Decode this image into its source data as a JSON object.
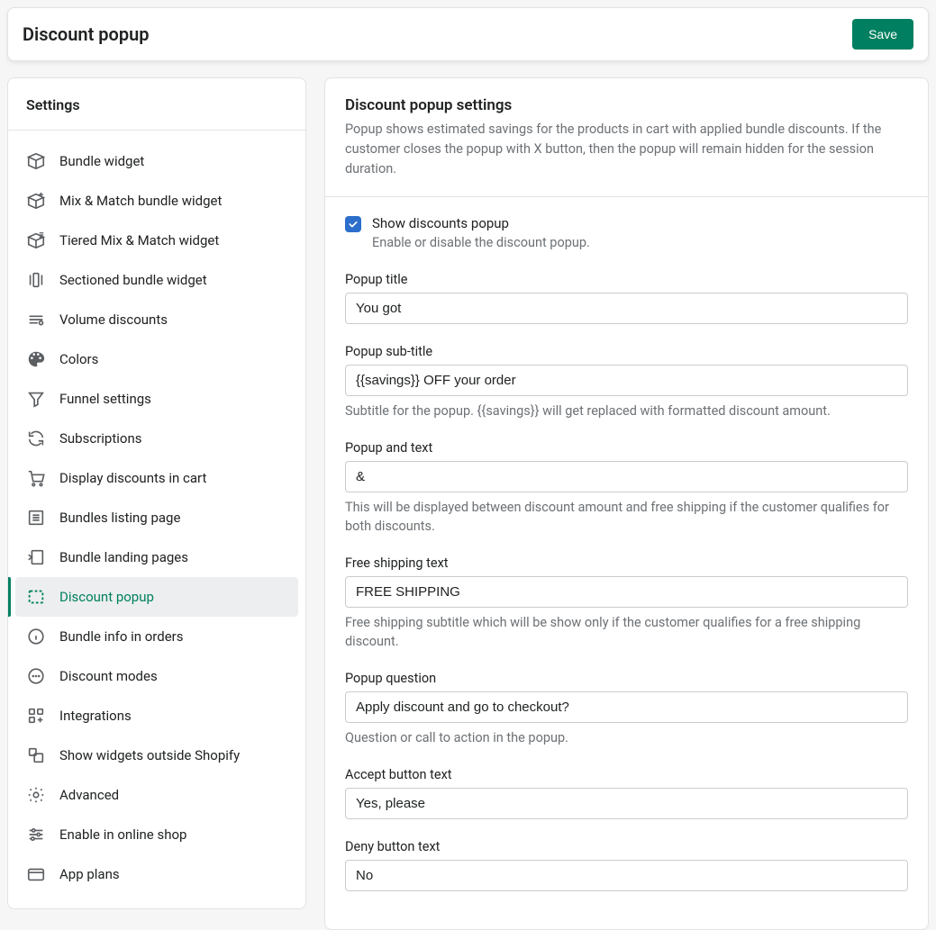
{
  "header": {
    "title": "Discount popup",
    "save_label": "Save"
  },
  "sidebar": {
    "title": "Settings",
    "items": [
      {
        "label": "Bundle widget",
        "icon": "box-icon",
        "active": false
      },
      {
        "label": "Mix & Match bundle widget",
        "icon": "box-plus-icon",
        "active": false
      },
      {
        "label": "Tiered Mix & Match widget",
        "icon": "box-tiers-icon",
        "active": false
      },
      {
        "label": "Sectioned bundle widget",
        "icon": "sections-icon",
        "active": false
      },
      {
        "label": "Volume discounts",
        "icon": "discount-icon",
        "active": false
      },
      {
        "label": "Colors",
        "icon": "palette-icon",
        "active": false
      },
      {
        "label": "Funnel settings",
        "icon": "funnel-icon",
        "active": false
      },
      {
        "label": "Subscriptions",
        "icon": "refresh-icon",
        "active": false
      },
      {
        "label": "Display discounts in cart",
        "icon": "cart-icon",
        "active": false
      },
      {
        "label": "Bundles listing page",
        "icon": "list-icon",
        "active": false
      },
      {
        "label": "Bundle landing pages",
        "icon": "page-import-icon",
        "active": false
      },
      {
        "label": "Discount popup",
        "icon": "popup-icon",
        "active": true
      },
      {
        "label": "Bundle info in orders",
        "icon": "info-icon",
        "active": false
      },
      {
        "label": "Discount modes",
        "icon": "modes-icon",
        "active": false
      },
      {
        "label": "Integrations",
        "icon": "integrations-icon",
        "active": false
      },
      {
        "label": "Show widgets outside Shopify",
        "icon": "external-icon",
        "active": false
      },
      {
        "label": "Advanced",
        "icon": "gear-icon",
        "active": false
      },
      {
        "label": "Enable in online shop",
        "icon": "sliders-icon",
        "active": false
      },
      {
        "label": "App plans",
        "icon": "card-icon",
        "active": false
      }
    ]
  },
  "main": {
    "title": "Discount popup settings",
    "description": "Popup shows estimated savings for the products in cart with applied bundle discounts. If the customer closes the popup with X button, then the popup will remain hidden for the session duration.",
    "checkbox": {
      "label": "Show discounts popup",
      "help": "Enable or disable the discount popup.",
      "checked": true
    },
    "fields": [
      {
        "label": "Popup title",
        "value": "You got",
        "help": ""
      },
      {
        "label": "Popup sub-title",
        "value": "{{savings}} OFF your order",
        "help": "Subtitle for the popup. {{savings}} will get replaced with formatted discount amount."
      },
      {
        "label": "Popup and text",
        "value": "&",
        "help": "This will be displayed between discount amount and free shipping if the customer qualifies for both discounts."
      },
      {
        "label": "Free shipping text",
        "value": "FREE SHIPPING",
        "help": "Free shipping subtitle which will be show only if the customer qualifies for a free shipping discount."
      },
      {
        "label": "Popup question",
        "value": "Apply discount and go to checkout?",
        "help": "Question or call to action in the popup."
      },
      {
        "label": "Accept button text",
        "value": "Yes, please",
        "help": ""
      },
      {
        "label": "Deny button text",
        "value": "No",
        "help": ""
      }
    ]
  }
}
